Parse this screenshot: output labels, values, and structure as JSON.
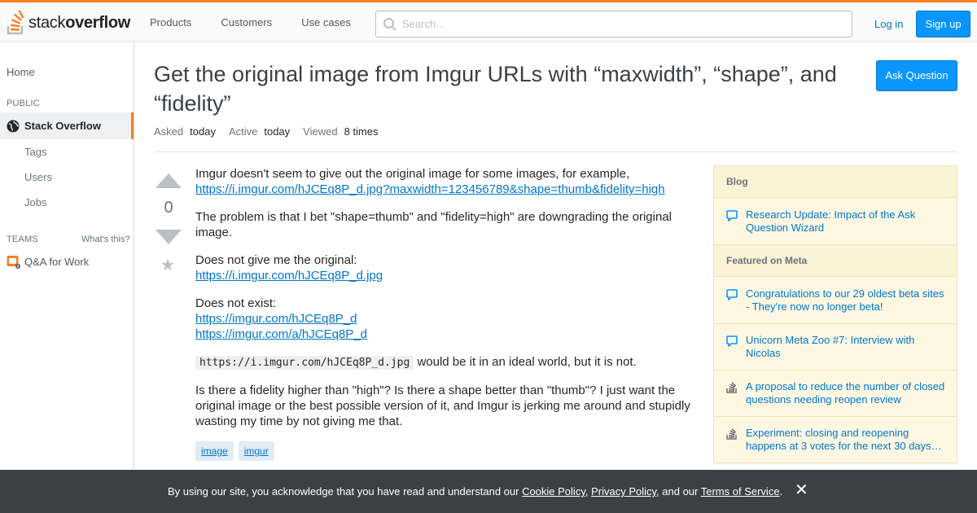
{
  "brand": {
    "logo_prefix": "stack",
    "logo_suffix": "overflow"
  },
  "nav": {
    "items": [
      "Products",
      "Customers",
      "Use cases"
    ]
  },
  "search": {
    "placeholder": "Search…"
  },
  "auth": {
    "login": "Log in",
    "signup": "Sign up"
  },
  "sidebar": {
    "home": "Home",
    "public_heading": "PUBLIC",
    "active": "Stack Overflow",
    "sub_items": [
      "Tags",
      "Users",
      "Jobs"
    ],
    "teams_heading": "TEAMS",
    "whats_this": "What's this?",
    "qa_work": "Q&A for Work"
  },
  "question": {
    "title": "Get the original image from Imgur URLs with “maxwidth”, “shape”, and “fidelity”",
    "ask_button": "Ask Question",
    "asked_label": "Asked",
    "asked_value": "today",
    "active_label": "Active",
    "active_value": "today",
    "viewed_label": "Viewed",
    "viewed_value": "8 times",
    "votes": "0",
    "p1_text": "Imgur doesn't seem to give out the original image for some images, for example,",
    "p1_link": "https://i.imgur.com/hJCEq8P_d.jpg?maxwidth=123456789&shape=thumb&fidelity=high",
    "p2_text": "The problem is that I bet \"shape=thumb\" and \"fidelity=high\" are downgrading the original image.",
    "p3_text": "Does not give me the original:",
    "p3_link": "https://i.imgur.com/hJCEq8P_d.jpg",
    "p4_text": "Does not exist:",
    "p4_link1": "https://imgur.com/hJCEq8P_d",
    "p4_link2": "https://imgur.com/a/hJCEq8P_d",
    "p5_code": "https://i.imgur.com/hJCEq8P_d.jpg",
    "p5_text": " would be it in an ideal world, but it is not.",
    "p6_text": "Is there a fidelity higher than \"high\"? Is there a shape better than \"thumb\"? I just want the original image or the best possible version of it, and Imgur is jerking me around and stupidly wasting my time by not giving me that.",
    "tags": [
      "image",
      "imgur"
    ]
  },
  "widget": {
    "blog_heading": "Blog",
    "blog_items": [
      "Research Update: Impact of the Ask Question Wizard"
    ],
    "meta_heading": "Featured on Meta",
    "meta_items": [
      "Congratulations to our 29 oldest beta sites - They're now no longer beta!",
      "Unicorn Meta Zoo #7: Interview with Nicolas",
      "A proposal to reduce the number of closed questions needing reopen review",
      "Experiment: closing and reopening happens at 3 votes for the next 30 days…"
    ]
  },
  "cookie": {
    "prefix": "By using our site, you acknowledge that you have read and understand our ",
    "cookie_policy": "Cookie Policy",
    "comma": ", ",
    "privacy_policy": "Privacy Policy",
    "and_our": ", and our ",
    "terms": "Terms of Service",
    "period": ".",
    "close": "✕"
  },
  "colors": {
    "accent": "#f48024",
    "primary": "#0a95ff",
    "link": "#0077cc",
    "widget_bg": "#fdf7e2",
    "banner_bg": "#3b4045"
  }
}
